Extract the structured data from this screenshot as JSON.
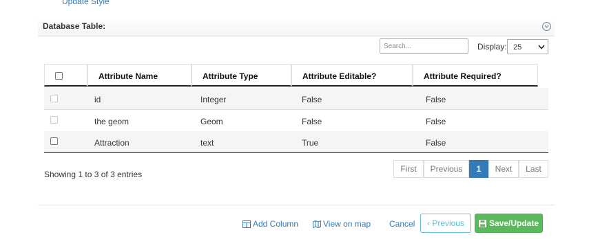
{
  "top_link": "Update Style",
  "section": {
    "title": "Database Table:"
  },
  "search": {
    "placeholder": "Search..."
  },
  "display": {
    "label": "Display:",
    "value": "25"
  },
  "table": {
    "headers": [
      "Attribute Name",
      "Attribute Type",
      "Attribute Editable?",
      "Attribute Required?"
    ],
    "rows": [
      {
        "name": "id",
        "type": "Integer",
        "editable": "False",
        "required": "False",
        "checkbox_enabled": false
      },
      {
        "name": "the geom",
        "type": "Geom",
        "editable": "False",
        "required": "False",
        "checkbox_enabled": false
      },
      {
        "name": "Attraction",
        "type": "text",
        "editable": "True",
        "required": "False",
        "checkbox_enabled": true
      }
    ]
  },
  "info": "Showing 1 to 3 of 3 entries",
  "pagination": {
    "first": "First",
    "previous": "Previous",
    "current": "1",
    "next": "Next",
    "last": "Last"
  },
  "footer": {
    "add_column": "Add Column",
    "view_on_map": "View on map",
    "cancel": "Cancel",
    "previous": "Previous",
    "save": "Save/Update"
  },
  "colors": {
    "accent": "#337ab7",
    "success": "#5cb85c",
    "info": "#5bc0de"
  }
}
